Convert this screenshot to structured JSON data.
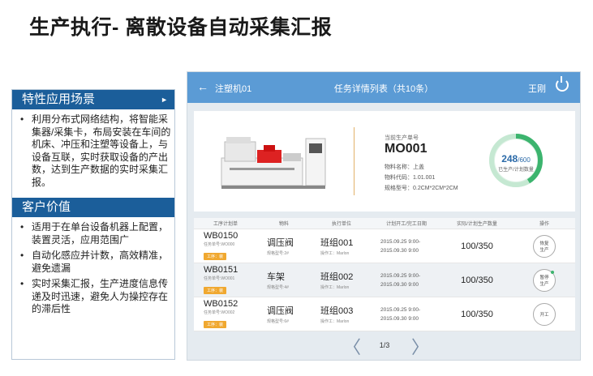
{
  "slide": {
    "title": "生产执行- 离散设备自动采集汇报"
  },
  "left": {
    "section1": {
      "title": "特性应用场景",
      "bullets": [
        "利用分布式网络结构，将智能采集器/采集卡，布局安装在车间的机床、冲压和注塑等设备上，与设备互联，实时获取设备的产出数，达到生产数据的实时采集汇报。"
      ]
    },
    "section2": {
      "title": "客户价值",
      "bullets": [
        "适用于在单台设备机器上配置，装置灵活，应用范围广",
        "自动化感应并计数，高效精准，避免遗漏",
        "实时采集汇报，生产进度信息传递及时迅速，避免人为操控存在的滞后性"
      ]
    }
  },
  "app": {
    "header": {
      "back": "←",
      "machine": "注塑机01",
      "title": "任务详情列表（共10条）",
      "user": "王刚"
    },
    "info": {
      "order_label": "当前生产单号",
      "order_value": "MO001",
      "meta": [
        "物料名称：上盖",
        "物料代码：1.01.001",
        "规格型号：0.2CM*2CM*2CM"
      ],
      "gauge": {
        "done": "248",
        "total": "/600",
        "label": "已生产/计划数量",
        "progress": 0.413
      }
    },
    "table": {
      "headers": [
        "工序计划单",
        "物料",
        "执行单位",
        "计划开工/完工日期",
        "实际/计划生产数量",
        "操作"
      ],
      "rows": [
        {
          "plan": "WB0150",
          "task": "任务单号:WO000",
          "badge": "工序：装",
          "mat": "调压阀",
          "spec": "规格型号:2#",
          "unit": "班组001",
          "worker": "操作工：Marlon",
          "start": "2015.09.25 9:00-",
          "end": "2015.09.30 9:00",
          "count": "100/350",
          "op1": "恢复",
          "op2": "生产"
        },
        {
          "plan": "WB0151",
          "task": "任务单号:WO001",
          "badge": "工序：装",
          "mat": "车架",
          "spec": "规格型号:4#",
          "unit": "班组002",
          "worker": "操作工：Marlon",
          "start": "2015.09.25 9:00-",
          "end": "2015.09.30 9:00",
          "count": "100/350",
          "op1": "暂停",
          "op2": "生产"
        },
        {
          "plan": "WB0152",
          "task": "任务单号:WO002",
          "badge": "工序：装",
          "mat": "调压阀",
          "spec": "规格型号:6#",
          "unit": "班组003",
          "worker": "操作工：Marlon",
          "start": "2015.09.25 9:00-",
          "end": "2015.09.30 9:00",
          "count": "100/350",
          "op1": "开工",
          "op2": ""
        }
      ]
    },
    "pager": {
      "prev": "〈",
      "page": "1/3",
      "next": "〉"
    },
    "colors": {
      "header": "#5b9bd5",
      "gauge": "#3cb46e",
      "badge": "#f0a830",
      "section": "#1b5e9a"
    }
  }
}
